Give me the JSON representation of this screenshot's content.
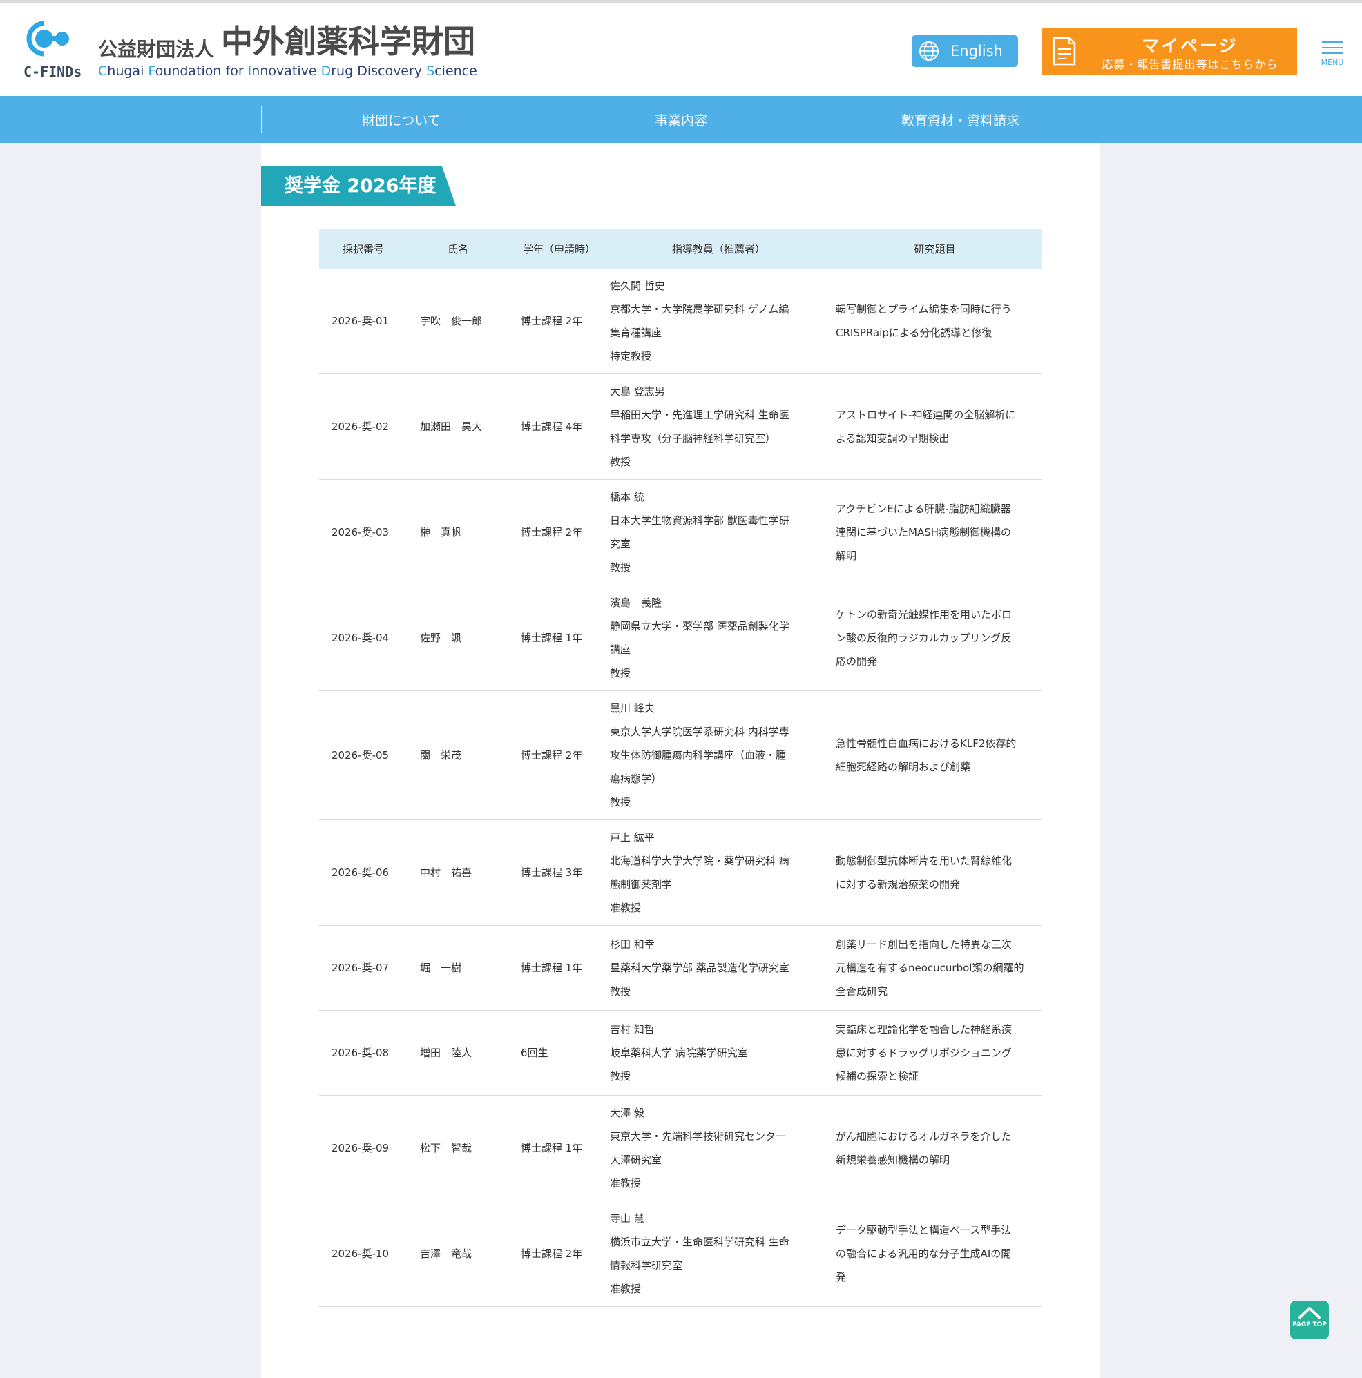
{
  "header": {
    "logo_text": "C-FINDs",
    "org_prefix": "公益財団法人",
    "org_name": "中外創薬科学財団",
    "org_en_parts": [
      {
        "hl": "C",
        "rest": "hugai "
      },
      {
        "hl": "F",
        "rest": "oundation for "
      },
      {
        "hl": "I",
        "rest": "nnovative "
      },
      {
        "hl": "D",
        "rest": "rug Discovery "
      },
      {
        "hl": "S",
        "rest": "cience"
      }
    ],
    "english_label": "English",
    "mypage_title": "マイページ",
    "mypage_sub": "応募・報告書提出等はこちらから",
    "menu_label": "MENU"
  },
  "nav": {
    "items": [
      "財団について",
      "事業内容",
      "教育資材・資料請求"
    ]
  },
  "section_title": "奨学金 2026年度",
  "table": {
    "headers": [
      "採択番号",
      "氏名",
      "学年（申請時）",
      "指導教員（推薦者）",
      "研究題目"
    ],
    "rows": [
      {
        "id": "2026-奨-01",
        "name": "宇吹　俊一郎",
        "grade": "博士課程 2年",
        "teacher": [
          "佐久間 哲史",
          "京都大学・大学院農学研究科 ゲノム編",
          "集育種講座",
          "特定教授"
        ],
        "topic": [
          "転写制御とプライム編集を同時に行う",
          "CRISPRaipによる分化誘導と修復"
        ]
      },
      {
        "id": "2026-奨-02",
        "name": "加瀬田　昊大",
        "grade": "博士課程 4年",
        "teacher": [
          "大島 登志男",
          "早稲田大学・先進理工学研究科 生命医",
          "科学専攻（分子脳神経科学研究室）",
          "教授"
        ],
        "topic": [
          "アストロサイト-神経連関の全脳解析に",
          "よる認知変調の早期検出"
        ]
      },
      {
        "id": "2026-奨-03",
        "name": "榊　真帆",
        "grade": "博士課程 2年",
        "teacher": [
          "橋本 統",
          "日本大学生物資源科学部 獣医毒性学研",
          "究室",
          "教授"
        ],
        "topic": [
          "アクチビンEによる肝臓-脂肪組織臓器",
          "連関に基づいたMASH病態制御機構の",
          "解明"
        ]
      },
      {
        "id": "2026-奨-04",
        "name": "佐野　颯",
        "grade": "博士課程 1年",
        "teacher": [
          "濱島　義隆",
          "静岡県立大学・薬学部 医薬品創製化学",
          "講座",
          "教授"
        ],
        "topic": [
          "ケトンの新奇光触媒作用を用いたボロ",
          "ン酸の反復的ラジカルカップリング反",
          "応の開発"
        ]
      },
      {
        "id": "2026-奨-05",
        "name": "關　栄茂",
        "grade": "博士課程 2年",
        "teacher": [
          "黒川 峰夫",
          "東京大学大学院医学系研究科 内科学専",
          "攻生体防御腫瘍内科学講座（血液・腫",
          "瘍病態学）",
          "教授"
        ],
        "topic": [
          "急性骨髄性白血病におけるKLF2依存的",
          "細胞死経路の解明および創薬"
        ]
      },
      {
        "id": "2026-奨-06",
        "name": "中村　祐喜",
        "grade": "博士課程 3年",
        "teacher": [
          "戸上 紘平",
          "北海道科学大学大学院・薬学研究科 病",
          "態制御薬剤学",
          "准教授"
        ],
        "topic": [
          "動態制御型抗体断片を用いた腎線維化",
          "に対する新規治療薬の開発"
        ]
      },
      {
        "id": "2026-奨-07",
        "name": "堀　一樹",
        "grade": "博士課程 1年",
        "teacher": [
          "杉田 和幸",
          "星薬科大学薬学部 薬品製造化学研究室",
          "教授"
        ],
        "topic": [
          "創薬リード創出を指向した特異な三次",
          "元構造を有するneocucurbol類の網羅的",
          "全合成研究"
        ]
      },
      {
        "id": "2026-奨-08",
        "name": "増田　陸人",
        "grade": "6回生",
        "teacher": [
          "吉村 知哲",
          "岐阜薬科大学 病院薬学研究室",
          "教授"
        ],
        "topic": [
          "実臨床と理論化学を融合した神経系疾",
          "患に対するドラッグリポジショニング",
          "候補の探索と検証"
        ]
      },
      {
        "id": "2026-奨-09",
        "name": "松下　智哉",
        "grade": "博士課程 1年",
        "teacher": [
          "大澤 毅",
          "東京大学・先端科学技術研究センター",
          "大澤研究室",
          "准教授"
        ],
        "topic": [
          "がん細胞におけるオルガネラを介した",
          "新規栄養感知機構の解明"
        ]
      },
      {
        "id": "2026-奨-10",
        "name": "吉澤　竜哉",
        "grade": "博士課程 2年",
        "teacher": [
          "寺山 慧",
          "横浜市立大学・生命医科学研究科 生命",
          "情報科学研究室",
          "准教授"
        ],
        "topic": [
          "データ駆動型手法と構造ベース型手法",
          "の融合による汎用的な分子生成AIの開",
          "発"
        ]
      }
    ]
  },
  "page_top_label": "PAGE TOP",
  "colors": {
    "nav_bg": "#4fb0e8",
    "title_bg": "#22a7b8",
    "mypage_bg": "#f8941c",
    "english_bg": "#4aaee6",
    "pagetop_bg": "#27b39b",
    "table_head_bg": "#d9eef6"
  }
}
